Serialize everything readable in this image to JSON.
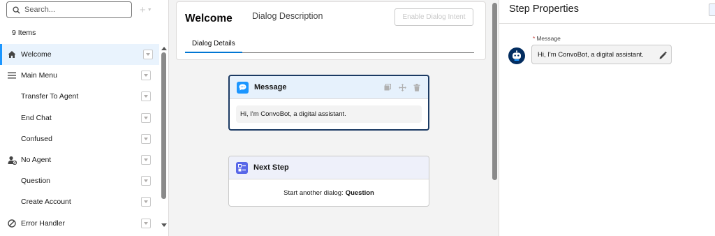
{
  "sidebar": {
    "search_placeholder": "Search...",
    "add_glyph": "+",
    "item_count": "9 Items",
    "items": [
      {
        "label": "Welcome",
        "icon": "home-icon",
        "active": true
      },
      {
        "label": "Main Menu",
        "icon": "menu-icon"
      },
      {
        "label": "Transfer To Agent",
        "icon": ""
      },
      {
        "label": "End Chat",
        "icon": ""
      },
      {
        "label": "Confused",
        "icon": ""
      },
      {
        "label": "No Agent",
        "icon": "agent-icon"
      },
      {
        "label": "Question",
        "icon": ""
      },
      {
        "label": "Create Account",
        "icon": ""
      },
      {
        "label": "Error Handler",
        "icon": "ban-icon"
      }
    ]
  },
  "dialog": {
    "title": "Welcome",
    "description_label": "Dialog Description",
    "enable_intent_label": "Enable Dialog Intent",
    "tabs": [
      {
        "label": "Dialog Details",
        "active": true
      }
    ]
  },
  "steps": {
    "message": {
      "title": "Message",
      "text": "Hi, I'm ConvoBot, a digital assistant.",
      "icon": "chat-bubble-icon"
    },
    "next_step": {
      "title": "Next Step",
      "prefix": "Start another dialog:",
      "target": "Question",
      "icon": "next-step-icon"
    }
  },
  "properties": {
    "title": "Step Properties",
    "field_label": "Message",
    "required_mark": "*",
    "message_value": "Hi, I'm ConvoBot, a digital assistant.",
    "avatar_icon": "bot-avatar-icon"
  },
  "colors": {
    "brand_blue": "#0176d3",
    "active_row": "#e9f3fd",
    "message_badge": "#1b96ff",
    "next_step_badge": "#5867e8",
    "selected_border": "#1b3a63",
    "avatar_bg": "#032d60"
  }
}
